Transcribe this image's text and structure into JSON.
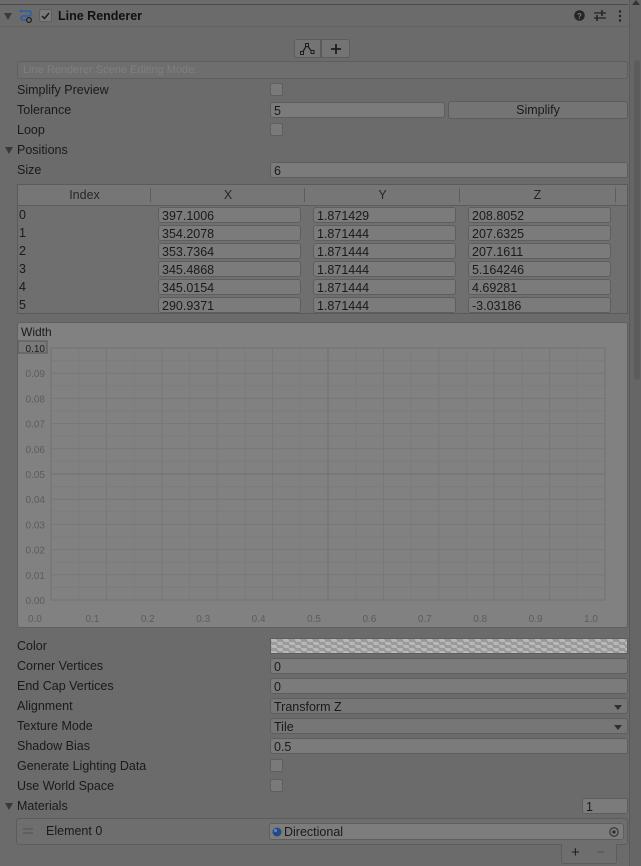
{
  "component": {
    "title": "Line Renderer",
    "enabled": true,
    "icons": [
      "line-renderer-icon",
      "help-icon",
      "presets-icon",
      "more-icon"
    ]
  },
  "edit_modes": {
    "buttons": [
      "edit-points-icon",
      "add-point-icon"
    ],
    "mode_label": "Line Renderer Scene Editing Mode:"
  },
  "simplify_preview": {
    "label": "Simplify Preview",
    "checked": false
  },
  "tolerance": {
    "label": "Tolerance",
    "value": "5",
    "button": "Simplify"
  },
  "loop": {
    "label": "Loop",
    "checked": false
  },
  "positions": {
    "label": "Positions",
    "size_label": "Size",
    "size": "6",
    "columns": [
      "Index",
      "X",
      "Y",
      "Z"
    ],
    "rows": [
      {
        "index": "0",
        "x": "397.1006",
        "y": "1.871429",
        "z": "208.8052"
      },
      {
        "index": "1",
        "x": "354.2078",
        "y": "1.871444",
        "z": "207.6325"
      },
      {
        "index": "2",
        "x": "353.7364",
        "y": "1.871444",
        "z": "207.1611"
      },
      {
        "index": "3",
        "x": "345.4868",
        "y": "1.871444",
        "z": "5.164246"
      },
      {
        "index": "4",
        "x": "345.0154",
        "y": "1.871444",
        "z": "4.69281"
      },
      {
        "index": "5",
        "x": "290.9371",
        "y": "1.871444",
        "z": "-3.03186"
      }
    ]
  },
  "chart_data": {
    "type": "line",
    "title": "Width",
    "xlabel": "",
    "ylabel": "",
    "xlim": [
      0.0,
      1.0
    ],
    "ylim": [
      0.0,
      0.1
    ],
    "x_ticks": [
      "0.0",
      "0.1",
      "0.2",
      "0.3",
      "0.4",
      "0.5",
      "0.6",
      "0.7",
      "0.8",
      "0.9",
      "1.0"
    ],
    "y_ticks": [
      "0.00",
      "0.01",
      "0.02",
      "0.03",
      "0.04",
      "0.05",
      "0.06",
      "0.07",
      "0.08",
      "0.09",
      "0.10"
    ],
    "highlighted_y_tick": "0.10",
    "grid": true,
    "series": []
  },
  "color": {
    "label": "Color"
  },
  "corner_vertices": {
    "label": "Corner Vertices",
    "value": "0"
  },
  "end_cap_vertices": {
    "label": "End Cap Vertices",
    "value": "0"
  },
  "alignment": {
    "label": "Alignment",
    "value": "Transform Z"
  },
  "texture_mode": {
    "label": "Texture Mode",
    "value": "Tile"
  },
  "shadow_bias": {
    "label": "Shadow Bias",
    "value": "0.5"
  },
  "generate_lighting": {
    "label": "Generate Lighting Data",
    "checked": false
  },
  "use_world_space": {
    "label": "Use World Space",
    "checked": false
  },
  "materials": {
    "label": "Materials",
    "count": "1",
    "elements": [
      {
        "label": "Element 0",
        "value": "Directional"
      }
    ],
    "add": "+",
    "remove": "−"
  }
}
